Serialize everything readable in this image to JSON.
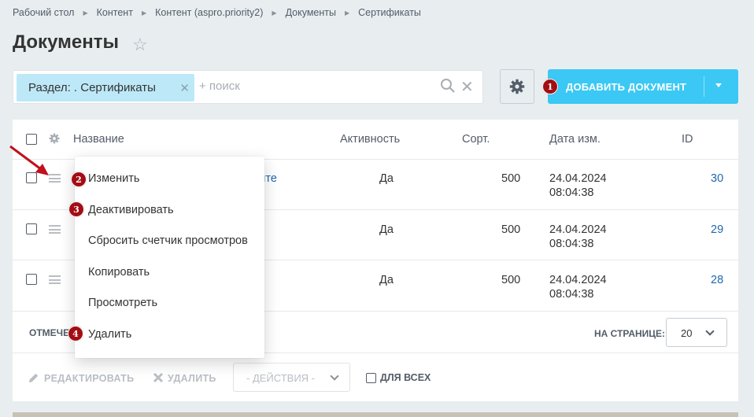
{
  "breadcrumb": [
    "Рабочий стол",
    "Контент",
    "Контент (aspro.priority2)",
    "Документы",
    "Сертификаты"
  ],
  "page_title": "Документы",
  "filter": {
    "tag_label": "Раздел: . Сертификаты",
    "search_placeholder": "+ поиск"
  },
  "add_button": {
    "label": "ДОБАВИТЬ ДОКУМЕНТ"
  },
  "grid": {
    "columns": [
      "Название",
      "Активность",
      "Сорт.",
      "Дата изм.",
      "ID"
    ],
    "rows": [
      {
        "name_fragment": "ците",
        "active": "Да",
        "sort": "500",
        "date": "24.04.2024",
        "time": "08:04:38",
        "id": "30"
      },
      {
        "name_fragment": "",
        "active": "Да",
        "sort": "500",
        "date": "24.04.2024",
        "time": "08:04:38",
        "id": "29"
      },
      {
        "name_fragment": "",
        "active": "Да",
        "sort": "500",
        "date": "24.04.2024",
        "time": "08:04:38",
        "id": "28"
      }
    ],
    "footer_left": "ОТМЕЧЕ",
    "per_page_label": "НА СТРАНИЦЕ:",
    "per_page_value": "20"
  },
  "actions": {
    "edit": "РЕДАКТИРОВАТЬ",
    "delete": "УДАЛИТЬ",
    "select": "- ДЕЙСТВИЯ -",
    "for_all": "ДЛЯ ВСЕХ"
  },
  "context_menu": [
    "Изменить",
    "Деактивировать",
    "Сбросить счетчик просмотров",
    "Копировать",
    "Просмотреть",
    "Удалить"
  ],
  "badges": [
    "1",
    "2",
    "3",
    "4"
  ],
  "colors": {
    "accent": "#3bc8f5",
    "badge": "#a30d14",
    "link": "#2067b0",
    "tag": "#bde8f8"
  }
}
